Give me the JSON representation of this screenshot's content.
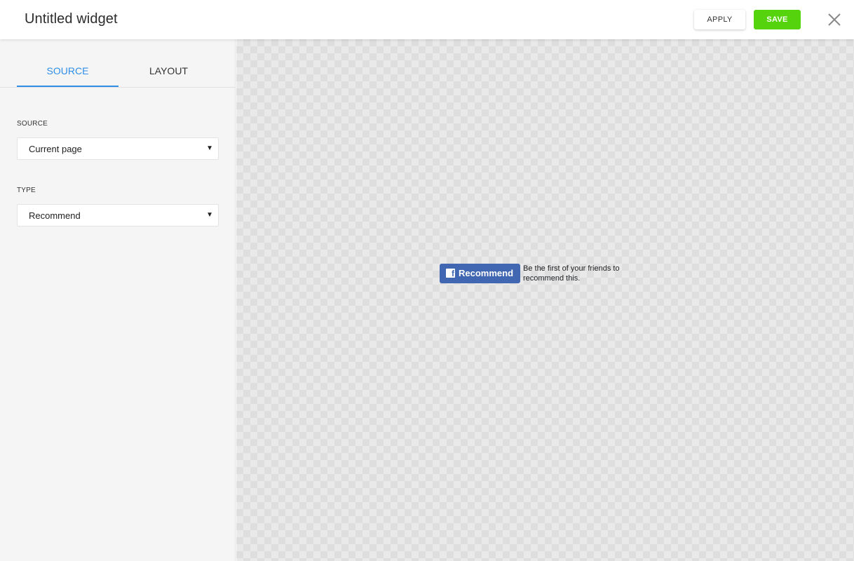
{
  "header": {
    "title": "Untitled widget",
    "apply_label": "APPLY",
    "save_label": "SAVE",
    "close_icon": "close-icon"
  },
  "sidebar": {
    "tabs": [
      {
        "label": "SOURCE",
        "active": true
      },
      {
        "label": "LAYOUT",
        "active": false
      }
    ],
    "fields": [
      {
        "label": "SOURCE",
        "value": "Current page"
      },
      {
        "label": "TYPE",
        "value": "Recommend"
      }
    ],
    "caret_glyph": "▼"
  },
  "preview": {
    "button_label": "Recommend",
    "social_text": "Be the first of your friends to recommend this.",
    "icon": "facebook-icon"
  },
  "colors": {
    "accent": "#2e8ee8",
    "save": "#55d40e",
    "facebook": "#4267b2",
    "sidebar_bg": "#f5f5f5"
  }
}
